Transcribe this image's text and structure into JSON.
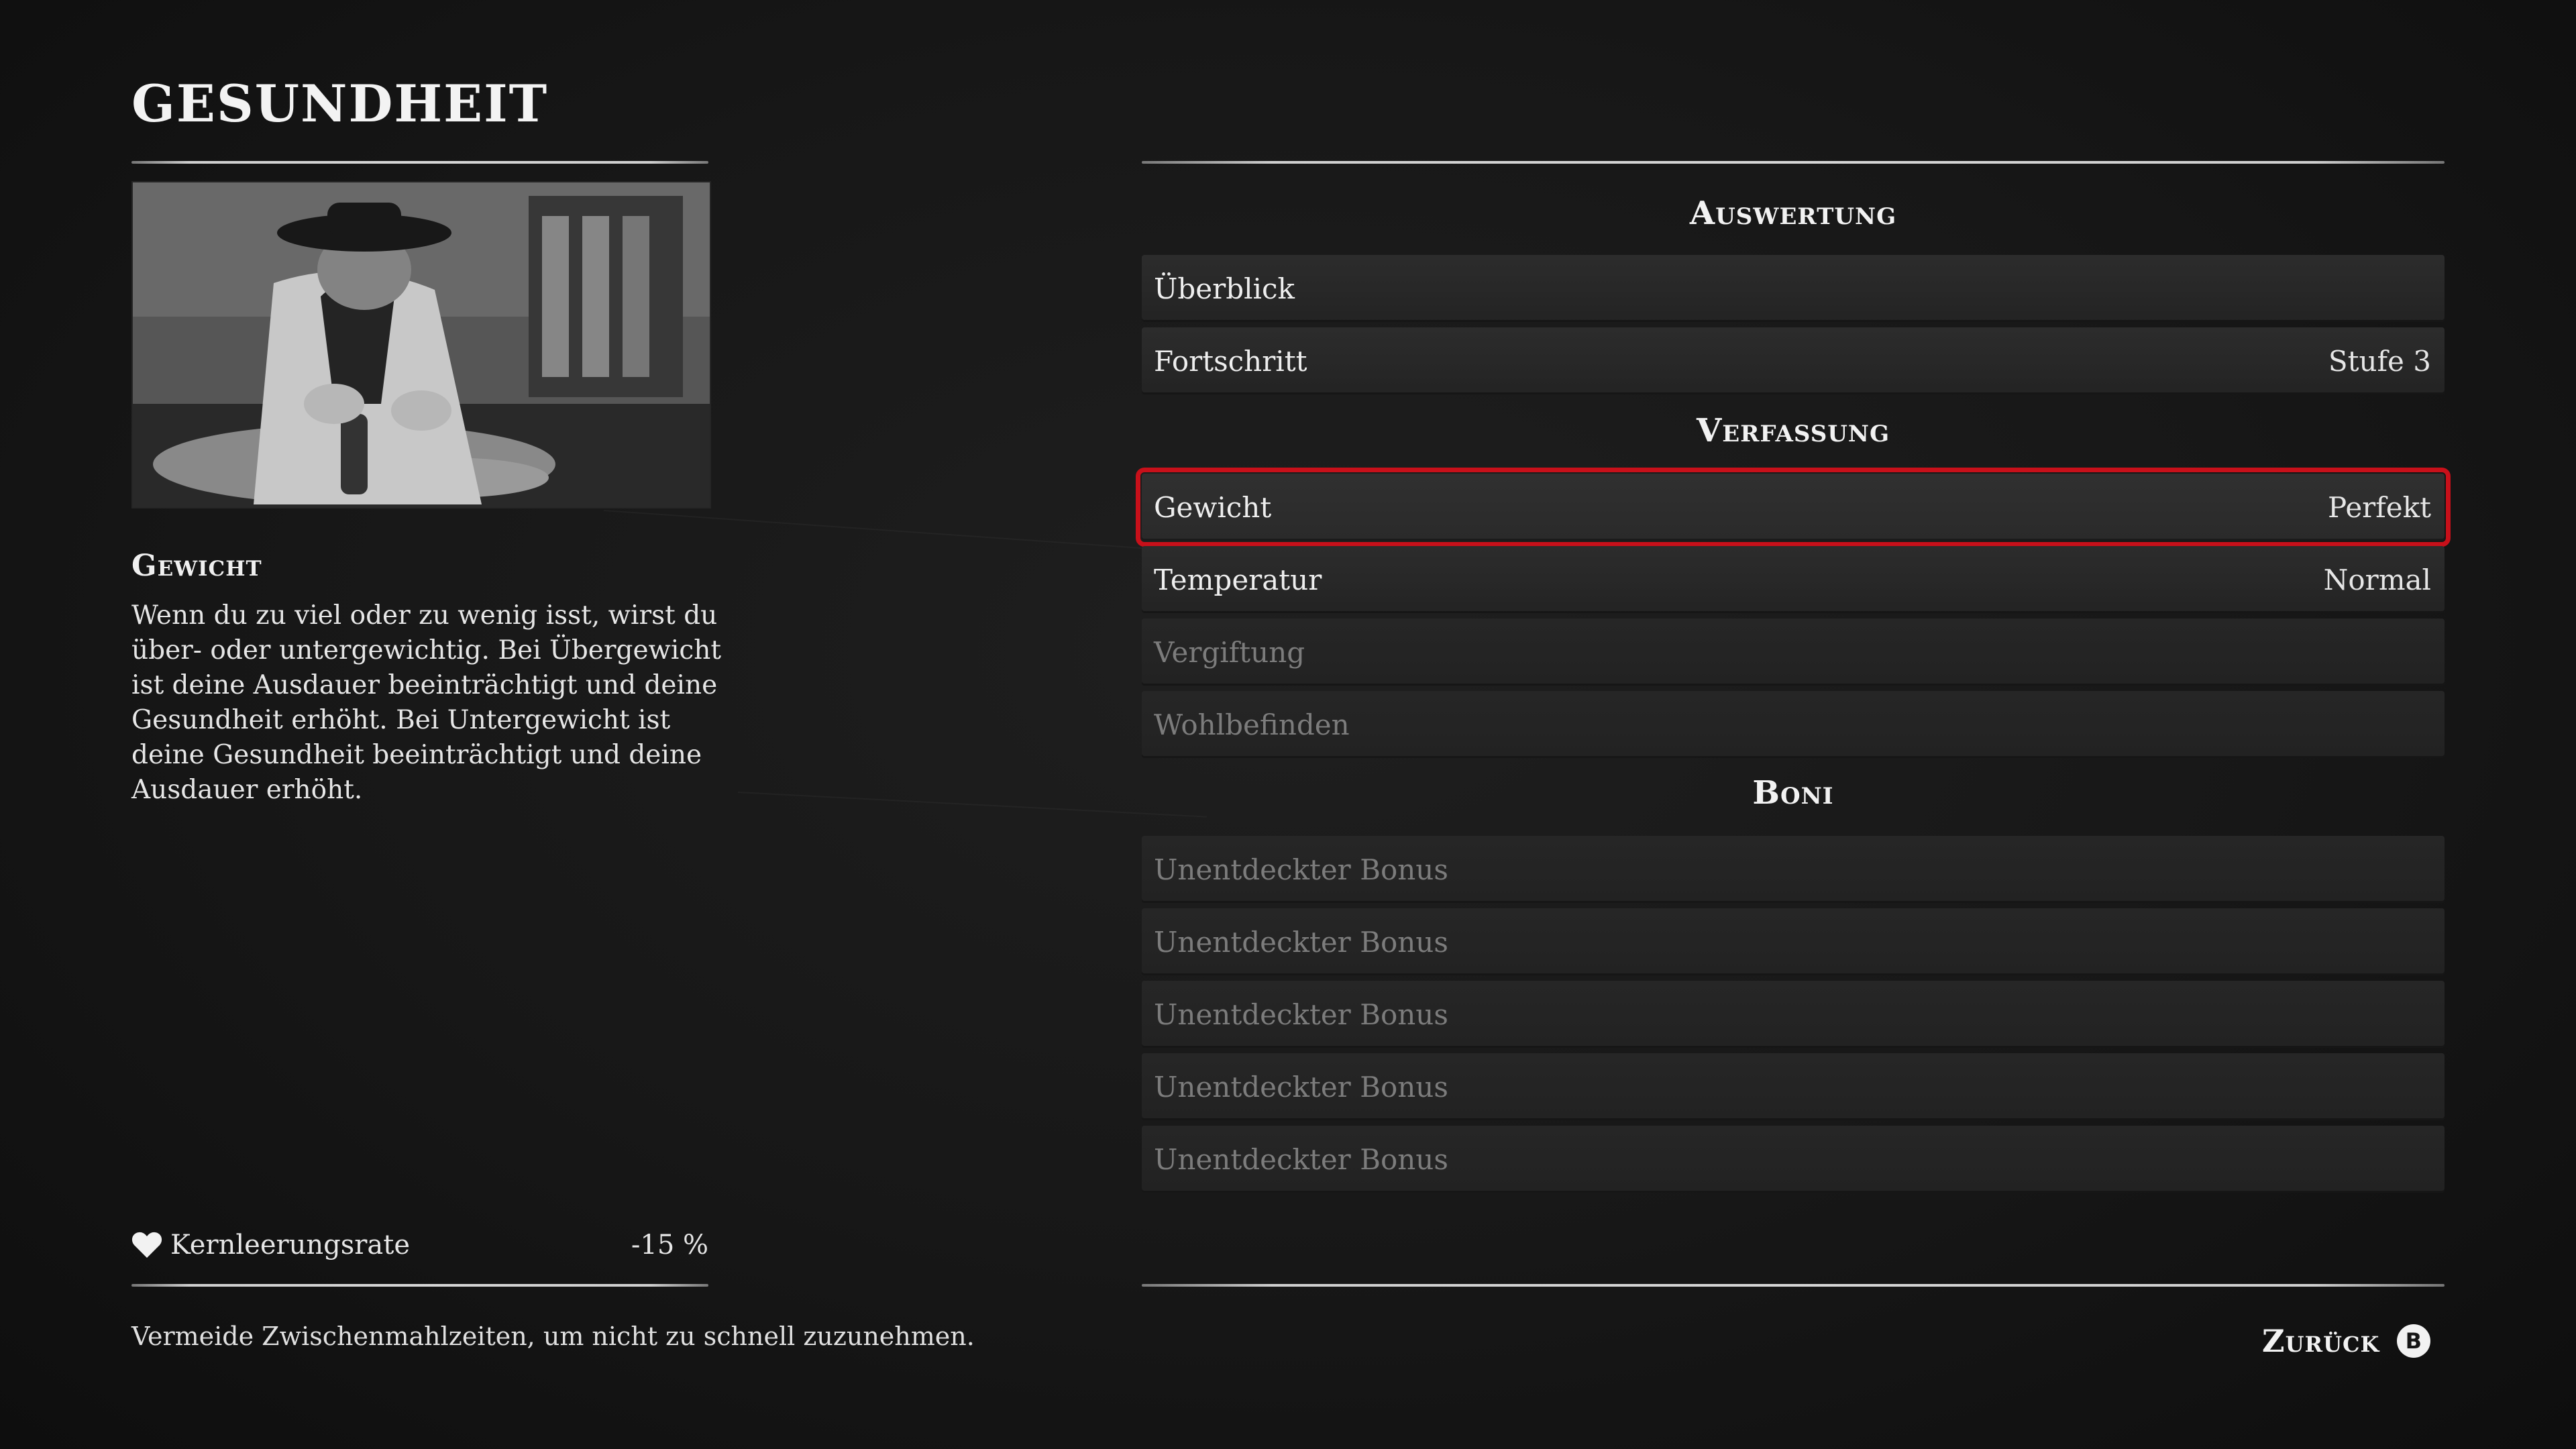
{
  "page": {
    "title": "GESUNDHEIT"
  },
  "detail": {
    "heading": "Gewicht",
    "body": "Wenn du zu viel oder zu wenig isst, wirst du über- oder untergewichtig. Bei Übergewicht ist deine Ausdauer beeinträchtigt und deine Gesundheit erhöht. Bei Untergewicht ist deine Gesundheit beeinträchtigt und deine Ausdauer erhöht.",
    "stat_icon": "heart-icon",
    "stat_label": "Kernleerungsrate",
    "stat_value": "-15 %",
    "hint": "Vermeide Zwischenmahlzeiten, um nicht zu schnell zuzunehmen."
  },
  "sections": {
    "auswertung": {
      "header": "Auswertung",
      "rows": [
        {
          "label": "Überblick",
          "value": ""
        },
        {
          "label": "Fortschritt",
          "value": "Stufe 3"
        }
      ]
    },
    "verfassung": {
      "header": "Verfassung",
      "rows": [
        {
          "label": "Gewicht",
          "value": "Perfekt",
          "selected": true
        },
        {
          "label": "Temperatur",
          "value": "Normal"
        },
        {
          "label": "Vergiftung",
          "value": "",
          "disabled": true
        },
        {
          "label": "Wohlbefinden",
          "value": "",
          "disabled": true
        }
      ]
    },
    "boni": {
      "header": "Boni",
      "rows": [
        {
          "label": "Unentdeckter Bonus"
        },
        {
          "label": "Unentdeckter Bonus"
        },
        {
          "label": "Unentdeckter Bonus"
        },
        {
          "label": "Unentdeckter Bonus"
        },
        {
          "label": "Unentdeckter Bonus"
        }
      ]
    }
  },
  "footer": {
    "back_label": "Zurück",
    "back_button": "B"
  },
  "colors": {
    "selection": "#c8101a",
    "background": "#141414"
  }
}
